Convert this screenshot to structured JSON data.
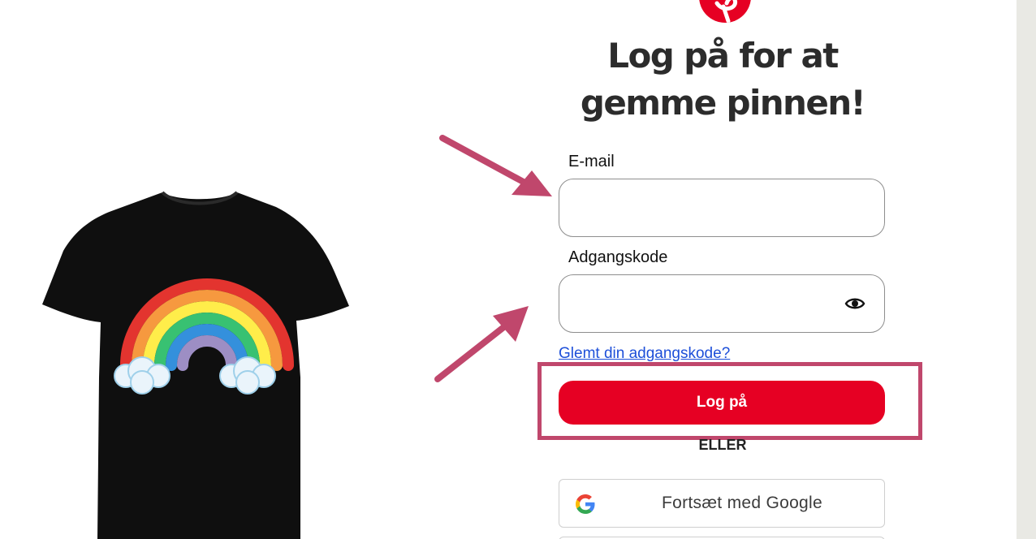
{
  "login": {
    "title_line1": "Log på for at",
    "title_line2": "gemme pinnen!",
    "email_label": "E-mail",
    "email_value": "",
    "password_label": "Adgangskode",
    "password_value": "",
    "forgot_password": "Glemt din adgangskode?",
    "login_button": "Log på",
    "or_divider": "ELLER",
    "google_button": "Fortsæt med Google"
  },
  "icons": {
    "logo": "pinterest-logo",
    "password_toggle": "eye-icon",
    "google": "google-g-icon"
  },
  "pin_image": {
    "subject": "black t-shirt with rainbow and clouds"
  },
  "annotations": {
    "color": "#c0476c",
    "markers": [
      "arrow-to-email",
      "arrow-to-password",
      "box-around-login-button"
    ]
  },
  "colors": {
    "brand": "#e60023",
    "link": "#1d4fd9",
    "annotation": "#c0476c"
  }
}
